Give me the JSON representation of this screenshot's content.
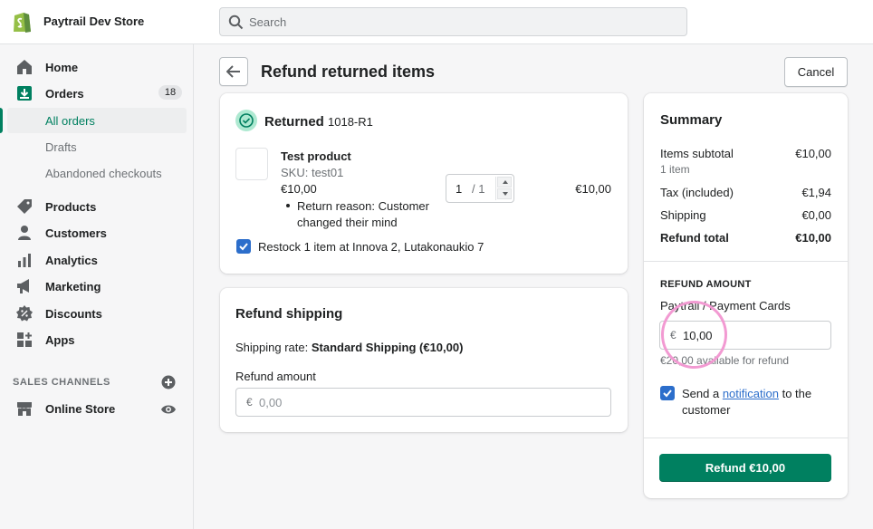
{
  "topbar": {
    "store_name": "Paytrail Dev Store",
    "search_placeholder": "Search"
  },
  "sidebar": {
    "home": "Home",
    "orders": "Orders",
    "orders_count": "18",
    "all_orders": "All orders",
    "drafts": "Drafts",
    "abandoned": "Abandoned checkouts",
    "products": "Products",
    "customers": "Customers",
    "analytics": "Analytics",
    "marketing": "Marketing",
    "discounts": "Discounts",
    "apps": "Apps",
    "sales_channels": "SALES CHANNELS",
    "online_store": "Online Store"
  },
  "header": {
    "title": "Refund returned items",
    "cancel": "Cancel"
  },
  "returned": {
    "title": "Returned",
    "id": "1018-R1",
    "product_name": "Test product",
    "sku": "SKU: test01",
    "price": "€10,00",
    "reason": "Return reason: Customer changed their mind",
    "qty_value": "1",
    "qty_max": "/ 1",
    "line_total": "€10,00",
    "restock": "Restock 1 item at Innova 2, Lutakonaukio 7"
  },
  "shipping": {
    "title": "Refund shipping",
    "rate_label": "Shipping rate: ",
    "rate_value": "Standard Shipping (€10,00)",
    "amount_label": "Refund amount",
    "currency": "€",
    "amount_placeholder": "0,00"
  },
  "summary": {
    "title": "Summary",
    "items_subtotal_label": "Items subtotal",
    "items_subtotal_value": "€10,00",
    "items_count": "1 item",
    "tax_label": "Tax (included)",
    "tax_value": "€1,94",
    "shipping_label": "Shipping",
    "shipping_value": "€0,00",
    "refund_total_label": "Refund total",
    "refund_total_value": "€10,00",
    "refund_amount_heading": "REFUND AMOUNT",
    "payment_method": "Paytrail / Payment Cards",
    "currency": "€",
    "refund_value": "10,00",
    "available": "€20,00 available for refund",
    "notify_prefix": "Send a ",
    "notify_link": "notification",
    "notify_suffix": " to the customer",
    "refund_button": "Refund €10,00"
  },
  "colors": {
    "primary": "#008060",
    "checkbox": "#2c6ecb",
    "highlight_circle": "#f29ad2"
  }
}
